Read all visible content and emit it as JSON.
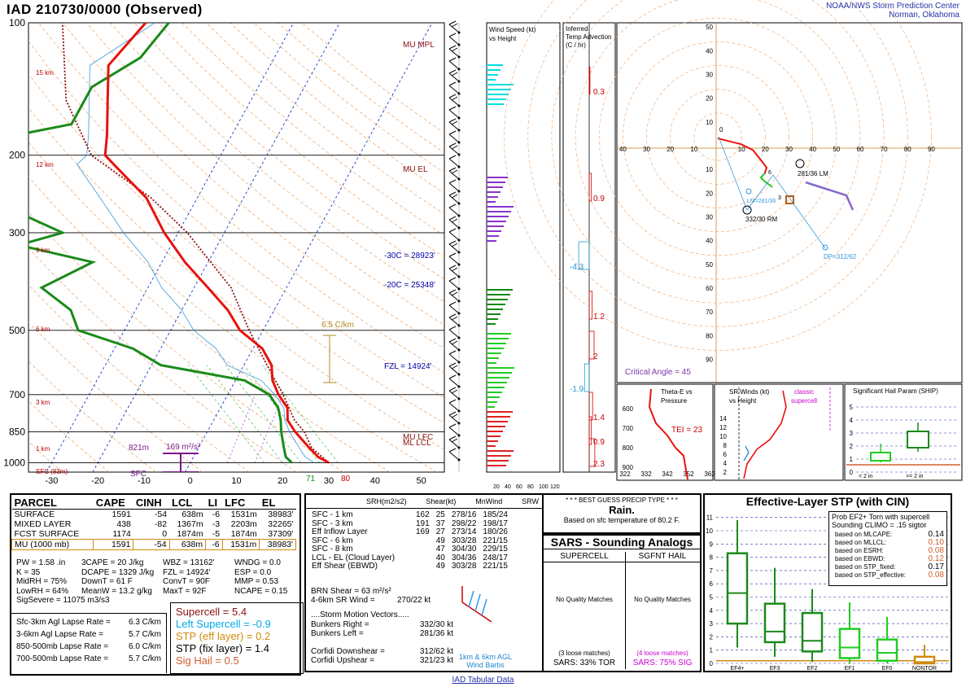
{
  "header": {
    "title": "IAD   210730/0000  (Observed)",
    "agency_line1": "NOAA/NWS Storm Prediction Center",
    "agency_line2": "Norman, Oklahoma"
  },
  "colors": {
    "temp": "#e8120c",
    "dewpoint": "#1a8a1a",
    "parcel": "#8b1010",
    "wetbulb": "#00aaee",
    "hodo": "#e8120c"
  },
  "chart_data": [
    {
      "type": "line",
      "name": "Skew-T log-p",
      "pressure_ticks": [
        100,
        200,
        300,
        500,
        700,
        850,
        1000
      ],
      "temp_ticks": [
        -30,
        -20,
        -10,
        0,
        10,
        20,
        30,
        40,
        50
      ],
      "height_labels": [
        "15 km",
        "12 km",
        "9 km",
        "6 km",
        "3 km",
        "1 km",
        "SFC (83m)"
      ],
      "temperature_profile": [
        [
          1000,
          30
        ],
        [
          970,
          27
        ],
        [
          925,
          24
        ],
        [
          850,
          19
        ],
        [
          800,
          16
        ],
        [
          750,
          14.5
        ],
        [
          700,
          11
        ],
        [
          650,
          8
        ],
        [
          600,
          6
        ],
        [
          550,
          2
        ],
        [
          500,
          -5
        ],
        [
          450,
          -10
        ],
        [
          400,
          -17
        ],
        [
          350,
          -25
        ],
        [
          300,
          -33
        ],
        [
          250,
          -41
        ],
        [
          210,
          -52
        ],
        [
          200,
          -55
        ],
        [
          180,
          -57
        ],
        [
          150,
          -61
        ],
        [
          125,
          -65
        ],
        [
          100,
          -62
        ]
      ],
      "dewpoint_profile": [
        [
          1000,
          22
        ],
        [
          970,
          20
        ],
        [
          925,
          18.5
        ],
        [
          850,
          16
        ],
        [
          800,
          14.5
        ],
        [
          750,
          12.5
        ],
        [
          700,
          9
        ],
        [
          650,
          2
        ],
        [
          600,
          -18
        ],
        [
          550,
          -26
        ],
        [
          500,
          -40
        ],
        [
          450,
          -44
        ],
        [
          400,
          -53
        ],
        [
          350,
          -45
        ],
        [
          320,
          -63
        ],
        [
          300,
          -55
        ],
        [
          270,
          -67
        ],
        [
          250,
          -67
        ],
        [
          230,
          -80
        ],
        [
          210,
          -72
        ],
        [
          190,
          -87
        ],
        [
          170,
          -66
        ],
        [
          140,
          -66
        ],
        [
          120,
          -59
        ],
        [
          100,
          -57
        ]
      ],
      "parcel_profile": [
        [
          1000,
          30
        ],
        [
          925,
          24.5
        ],
        [
          850,
          21
        ],
        [
          800,
          17.5
        ],
        [
          700,
          12
        ],
        [
          600,
          5
        ],
        [
          500,
          -3
        ],
        [
          400,
          -12
        ],
        [
          300,
          -28
        ],
        [
          250,
          -40
        ],
        [
          200,
          -58
        ],
        [
          150,
          -70
        ],
        [
          100,
          -80
        ]
      ],
      "annotations": [
        "MU MPL",
        "MU EL",
        "MU LFC",
        "ML LCL",
        "-30C = 28923'",
        "-20C = 25348'",
        "FZL = 14924'",
        "6.5 C/km",
        "821m",
        "169 m²/s²",
        "SFC",
        "71",
        "80"
      ]
    },
    {
      "type": "line",
      "name": "Hodograph",
      "rings": [
        10,
        20,
        30,
        40,
        50,
        60,
        70,
        80,
        90
      ],
      "axis_ticks": [
        10,
        20,
        30,
        40,
        50,
        60,
        70,
        80,
        90
      ],
      "points": [
        [
          0,
          0
        ],
        [
          8,
          -2
        ],
        [
          12,
          -3
        ],
        [
          18,
          -6
        ],
        [
          22,
          -11
        ],
        [
          25,
          -15
        ],
        [
          24,
          -18
        ],
        [
          22,
          -20
        ],
        [
          24,
          -22
        ],
        [
          28,
          -25
        ],
        [
          32,
          -31
        ],
        [
          33,
          -35
        ]
      ],
      "labels": [
        "0",
        "1",
        "3",
        "6",
        "9",
        "281/36 LM",
        "332/30 RM",
        "LM=281/36",
        "DP=312/62"
      ],
      "critical_angle_label": "Critical Angle = 45"
    },
    {
      "type": "bar",
      "name": "Wind Speed vs Height",
      "xlabels": [
        "20",
        "40",
        "60",
        "80",
        "100",
        "120"
      ]
    },
    {
      "type": "bar",
      "name": "Inferred Temp Advection",
      "values": [
        0.3,
        0.9,
        -4.3,
        1.2,
        2.0,
        -1.9,
        1.4,
        0.9,
        2.3
      ]
    },
    {
      "type": "line",
      "name": "Theta-E vs Pressure",
      "yticks": [
        600,
        700,
        800,
        900
      ],
      "xticks": [
        322,
        332,
        342,
        352,
        362
      ],
      "tei_label": "TEI = 23"
    },
    {
      "type": "line",
      "name": "SR Winds vs Height",
      "yticks": [
        2,
        4,
        6,
        8,
        10,
        12,
        14
      ],
      "note": "classic supercell"
    },
    {
      "type": "bar",
      "name": "Significant Hail Param (SHIP)",
      "yticks": [
        0,
        1,
        2,
        3,
        4,
        5
      ],
      "categories": [
        "< 2 in",
        ">= 2 in"
      ]
    },
    {
      "type": "bar",
      "name": "Effective-Layer STP (with CIN)",
      "yticks": [
        0,
        1,
        2,
        3,
        4,
        5,
        6,
        7,
        8,
        9,
        10,
        11
      ],
      "categories": [
        "EF4+",
        "EF3",
        "EF2",
        "EF1",
        "EF0",
        "NONTOR"
      ],
      "boxes": [
        {
          "cat": "EF4+",
          "low": 1.2,
          "q1": 3.0,
          "median": 5.3,
          "q3": 8.3,
          "high": 10.8,
          "color": "#1a8a1a"
        },
        {
          "cat": "EF3",
          "low": 0.5,
          "q1": 1.6,
          "median": 2.4,
          "q3": 4.5,
          "high": 7.2,
          "color": "#1a8a1a"
        },
        {
          "cat": "EF2",
          "low": 0.1,
          "q1": 0.9,
          "median": 1.7,
          "q3": 3.8,
          "high": 5.6,
          "color": "#1a8a1a"
        },
        {
          "cat": "EF1",
          "low": 0.0,
          "q1": 0.4,
          "median": 1.2,
          "q3": 2.6,
          "high": 4.6,
          "color": "#22cc22"
        },
        {
          "cat": "EF0",
          "low": 0.0,
          "q1": 0.2,
          "median": 0.8,
          "q3": 1.8,
          "high": 3.5,
          "color": "#22cc22"
        },
        {
          "cat": "NONTOR",
          "low": 0.0,
          "q1": 0.0,
          "median": 0.1,
          "q3": 0.5,
          "high": 1.4,
          "color": "#d08a10"
        }
      ],
      "prob_title": "Prob EF2+ Torn with supercell",
      "prob_subtitle": "Sounding CLIMO = .15 sigtor",
      "prob_rows": [
        {
          "label": "based on MLCAPE:",
          "value": "0.14",
          "color": "#000000"
        },
        {
          "label": "based on MLLCL:",
          "value": "0.10",
          "color": "#d06030"
        },
        {
          "label": "based on ESRH:",
          "value": "0.08",
          "color": "#d06030"
        },
        {
          "label": "based on EBWD:",
          "value": "0.12",
          "color": "#d06030"
        },
        {
          "label": "based on STP_fixed:",
          "value": "0.17",
          "color": "#000000"
        },
        {
          "label": "based on STP_effective:",
          "value": "0.08",
          "color": "#d06030"
        }
      ]
    }
  ],
  "skewt_text": {
    "mu_mpl": "MU MPL",
    "mu_el": "MU EL",
    "mu_lfc": "MU LFC",
    "ml_lcl": "ML LCL",
    "m30c": "-30C = 28923'",
    "m20c": "-20C = 25348'",
    "fzl": "FZL = 14924'",
    "lapse": "6.5 C/km",
    "inflow_base": "821m",
    "srh_val": "169 m²/s²",
    "sfc": "SFC",
    "td_sfc": "71",
    "t_sfc": "80",
    "km15": "15 km",
    "km12": "12 km",
    "km9": "9 km",
    "km6": "6 km",
    "km3": "3 km",
    "km1": "1 km",
    "sfc83": "SFC (83m)"
  },
  "windspeed_title": "Wind Speed (kt)\nvs Height",
  "advection_title": "Inferred\nTemp Advection\n(C / hr)",
  "thetae_title": "Theta-E vs\nPressure",
  "srwinds_title": "SR Winds (kt)\nvs Height",
  "ship_title": "Significant Hail Param (SHIP)",
  "ship_cat1": "< 2 in",
  "ship_cat2": ">= 2 in",
  "tei": "TEI = 23",
  "classic": "classic\nsupercell",
  "critical_angle": "Critical Angle = 45",
  "parcel_table": {
    "headers": [
      "PARCEL",
      "CAPE",
      "CINH",
      "LCL",
      "LI",
      "LFC",
      "EL"
    ],
    "rows": [
      [
        "SURFACE",
        "1591",
        "-54",
        "638m",
        "-6",
        "1531m",
        "38983'"
      ],
      [
        "MIXED LAYER",
        "438",
        "-82",
        "1367m",
        "-3",
        "2203m",
        "32265'"
      ],
      [
        "FCST SURFACE",
        "1174",
        "0",
        "1874m",
        "-5",
        "1874m",
        "37309'"
      ],
      [
        "MU   (1000 mb)",
        "1591",
        "-54",
        "638m",
        "-6",
        "1531m",
        "38983'"
      ]
    ]
  },
  "thermo_params": [
    [
      "PW = 1.58 .in",
      "3CAPE = 20 J/kg",
      "WBZ = 13162'",
      "WNDG = 0.0"
    ],
    [
      "K = 35",
      "DCAPE = 1329 J/kg",
      "FZL = 14924'",
      "ESP = 0.0"
    ],
    [
      "MidRH = 75%",
      "DownT = 61 F",
      "ConvT = 90F",
      "MMP = 0.53"
    ],
    [
      "LowRH = 64%",
      "MeanW = 13.2 g/kg",
      "MaxT = 92F",
      "NCAPE = 0.15"
    ],
    [
      "SigSevere = 11075 m3/s3",
      "",
      "",
      ""
    ]
  ],
  "lapse_rates": [
    [
      "Sfc-3km Agl Lapse Rate =",
      "6.3 C/km"
    ],
    [
      "3-6km Agl Lapse Rate =",
      "5.7 C/km"
    ],
    [
      "850-500mb Lapse Rate =",
      "6.0 C/km"
    ],
    [
      "700-500mb Lapse Rate =",
      "5.7 C/km"
    ]
  ],
  "composites": [
    {
      "text": "Supercell = 5.4",
      "color": "#8b1010"
    },
    {
      "text": "Left Supercell = -0.9",
      "color": "#00aaee"
    },
    {
      "text": "STP (eff layer) = 0.2",
      "color": "#d08a10"
    },
    {
      "text": "STP (fix layer) = 1.4",
      "color": "#000000"
    },
    {
      "text": "Sig Hail = 0.5",
      "color": "#d06030"
    }
  ],
  "kinematic": {
    "headers": [
      "SRH(m2/s2)",
      "Shear(kt)",
      "MnWind",
      "SRW"
    ],
    "rows": [
      [
        "SFC - 1 km",
        "162",
        "25",
        "278/16",
        "185/24"
      ],
      [
        "SFC - 3 km",
        "191",
        "37",
        "298/22",
        "198/17"
      ],
      [
        "Eff Inflow Layer",
        "169",
        "27",
        "273/14",
        "180/26"
      ],
      [
        "",
        "",
        "",
        "",
        ""
      ],
      [
        "SFC - 6 km",
        "",
        "49",
        "303/28",
        "221/15"
      ],
      [
        "SFC - 8 km",
        "",
        "47",
        "304/30",
        "229/15"
      ],
      [
        "LCL - EL (Cloud Layer)",
        "",
        "40",
        "304/36",
        "248/17"
      ],
      [
        "Eff Shear (EBWD)",
        "",
        "49",
        "303/28",
        "221/15"
      ]
    ],
    "brn_shear": "BRN Shear =  63 m²/s²",
    "sr_wind": "4-6km SR Wind =",
    "sr_wind_val": "270/22 kt",
    "storm_motion_title": "....Storm Motion Vectors.....",
    "motions": [
      [
        "Bunkers Right =",
        "332/30 kt"
      ],
      [
        "Bunkers Left =",
        "281/36 kt"
      ],
      [
        "",
        ""
      ],
      [
        "Corfidi Downshear =",
        "312/62 kt"
      ],
      [
        "Corfidi Upshear =",
        "321/23 kt"
      ]
    ],
    "barbs_label": "1km & 6km AGL\nWind Barbs"
  },
  "precip": {
    "title": "* * * BEST GUESS PRECIP TYPE * * *",
    "type": "Rain.",
    "basis": "Based on sfc temperature of 80.2 F."
  },
  "sars": {
    "title": "SARS - Sounding Analogs",
    "col1": "SUPERCELL",
    "col2": "SGFNT HAIL",
    "nomatch1": "No Quality Matches",
    "nomatch2": "No Quality Matches",
    "loose1": "(3 loose matches)",
    "loose2": "(4 loose matches)",
    "pct1": "SARS:  33% TOR",
    "pct2": "SARS:  75% SIG"
  },
  "stp_title": "Effective-Layer STP (with CIN)",
  "footer_link": "IAD Tabular Data"
}
